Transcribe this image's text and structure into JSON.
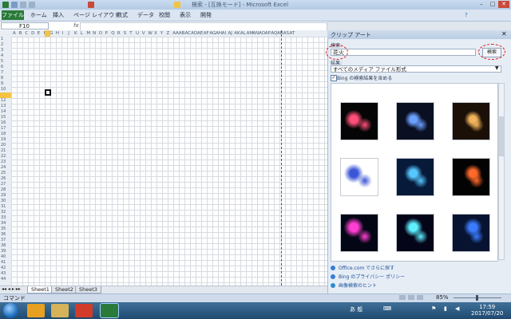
{
  "window": {
    "title": "検索 - [互換モード] - Microsoft Excel",
    "controls": {
      "min": "–",
      "max": "□",
      "close": "✕"
    },
    "help": "?"
  },
  "ribbon": {
    "file": "ファイル",
    "tabs": [
      "ホーム",
      "挿入",
      "ページ レイアウト",
      "数式",
      "データ",
      "校閲",
      "表示",
      "開発"
    ]
  },
  "formula_bar": {
    "name_box": "F10",
    "fx": "fx"
  },
  "sheet": {
    "columns": [
      "A",
      "B",
      "C",
      "D",
      "E",
      "F",
      "G",
      "H",
      "I",
      "J",
      "K",
      "L",
      "M",
      "N",
      "O",
      "P",
      "Q",
      "R",
      "S",
      "T",
      "U",
      "V",
      "W",
      "X",
      "Y",
      "Z",
      "AA",
      "AB",
      "AC",
      "AD",
      "AE",
      "AF",
      "AG",
      "AH",
      "AI",
      "AJ",
      "AK",
      "AL",
      "AM",
      "AN",
      "AO",
      "AP",
      "AQ",
      "AR",
      "AS",
      "AT"
    ],
    "active_cell": "F10",
    "tabs": [
      "Sheet1",
      "Sheet2",
      "Sheet3"
    ],
    "active_tab": "Sheet1"
  },
  "status": {
    "left": "コマンド",
    "zoom": "85%"
  },
  "clip_art": {
    "title": "クリップ アート",
    "search_label": "検索:",
    "search_value": "花火",
    "search_button": "検索",
    "type_label": "結果:",
    "type_value": "すべてのメディア ファイル形式",
    "bing_checkbox": "Bing の検索結果を含める",
    "bing_checked": true,
    "images": [
      {
        "name": "fireworks-multicolor",
        "bg": "#050505",
        "fg": "#ff4f7a"
      },
      {
        "name": "fireworks-city",
        "bg": "#0b0f22",
        "fg": "#6aa0ff"
      },
      {
        "name": "fireworks-gold",
        "bg": "#1a1007",
        "fg": "#f2b35a"
      },
      {
        "name": "fireworks-clipart",
        "bg": "#ffffff",
        "fg": "#3a55d6"
      },
      {
        "name": "fireworks-cyan",
        "bg": "#071a3a",
        "fg": "#57c7ff"
      },
      {
        "name": "fireworks-ring",
        "bg": "#030303",
        "fg": "#ff6a2a"
      },
      {
        "name": "fireworks-colorful",
        "bg": "#030615",
        "fg": "#ff3fd0"
      },
      {
        "name": "fireworks-burst",
        "bg": "#05051a",
        "fg": "#5ff0ff"
      },
      {
        "name": "fireworks-blue-night",
        "bg": "#071330",
        "fg": "#3b7bff"
      }
    ],
    "links": [
      "Office.com でさらに探す",
      "Bing のプライバシー ポリシー",
      "画像検索のヒント"
    ]
  },
  "taskbar": {
    "time": "17:59",
    "date": "2017/07/20",
    "ime": "あ 般"
  },
  "colors": {
    "excel_green": "#2a7a3a",
    "highlight": "#e01919",
    "active_header": "#f6c243"
  }
}
